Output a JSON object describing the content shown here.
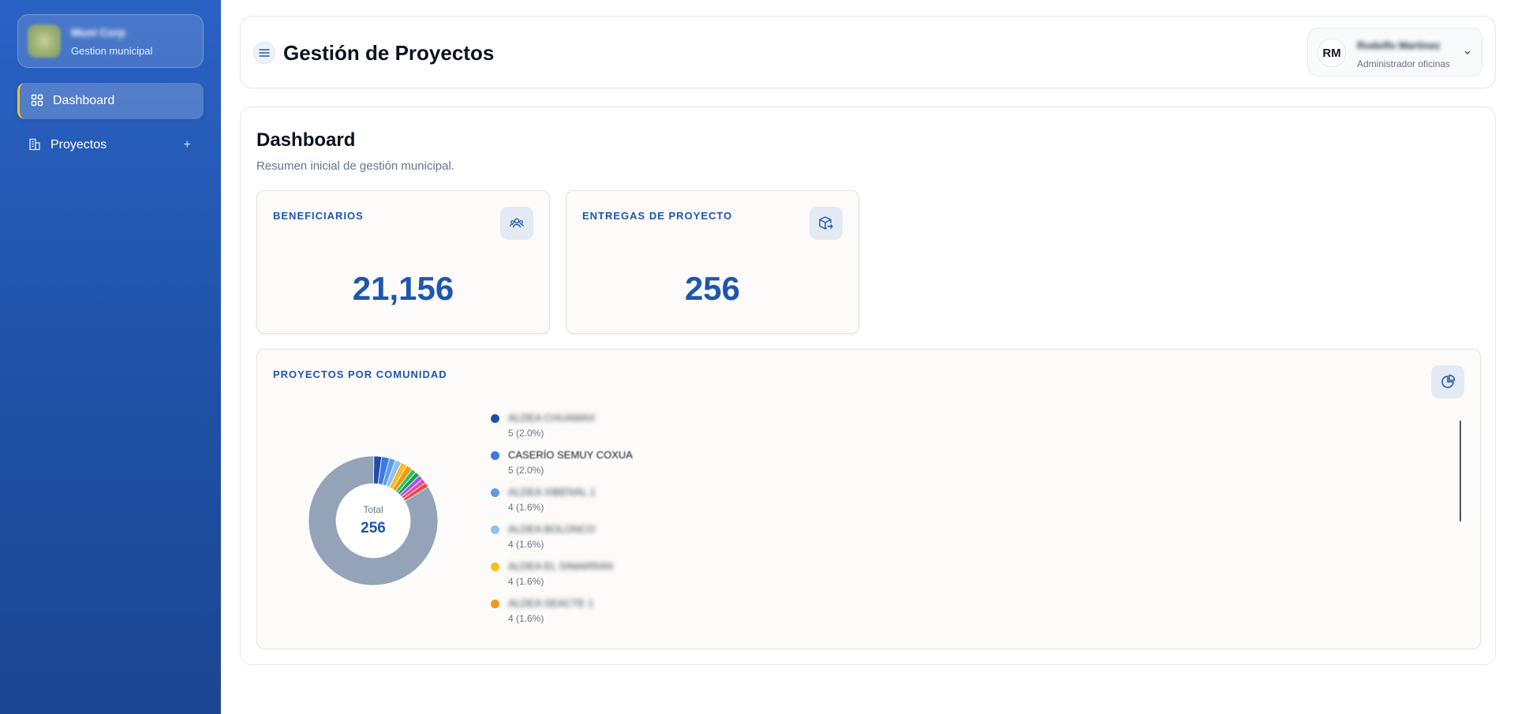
{
  "sidebar": {
    "brand": {
      "name": "Muni Corp",
      "subtitle": "Gestion municipal"
    },
    "items": [
      {
        "label": "Dashboard",
        "icon": "grid-icon",
        "active": true
      },
      {
        "label": "Proyectos",
        "icon": "building-icon",
        "expand": "+"
      }
    ]
  },
  "header": {
    "title": "Gestión de Proyectos",
    "user": {
      "initials": "RM",
      "name": "Rodolfo Martinez",
      "role": "Administrador oficinas"
    }
  },
  "dashboard": {
    "title": "Dashboard",
    "subtitle": "Resumen inicial de gestión municipal.",
    "cards": [
      {
        "label": "BENEFICIARIOS",
        "value": "21,156",
        "icon": "users-icon"
      },
      {
        "label": "ENTREGAS DE PROYECTO",
        "value": "256",
        "icon": "box-arrow-icon"
      }
    ],
    "chart": {
      "label": "PROYECTOS POR COMUNIDAD",
      "icon": "pie-chart-icon",
      "total_label": "Total",
      "total_value": "256"
    }
  },
  "chart_data": {
    "type": "pie",
    "title": "PROYECTOS POR COMUNIDAD",
    "total": 256,
    "series": [
      {
        "name": "ALDEA CHUAMAX",
        "value": 5,
        "percent": "5 (2.0%)",
        "color": "#1e4fa8"
      },
      {
        "name": "CASERÍO SEMUY COXUA",
        "value": 5,
        "percent": "5 (2.0%)",
        "color": "#3b7be0"
      },
      {
        "name": "ALDEA XIBENAL 1",
        "value": 4,
        "percent": "4 (1.6%)",
        "color": "#5f9ae8"
      },
      {
        "name": "ALDEA BOLONCO",
        "value": 4,
        "percent": "4 (1.6%)",
        "color": "#93bff2"
      },
      {
        "name": "ALDEA EL SIMARRAN",
        "value": 4,
        "percent": "4 (1.6%)",
        "color": "#f8be1a"
      },
      {
        "name": "ALDEA SEACTE 1",
        "value": 4,
        "percent": "4 (1.6%)",
        "color": "#f39a12"
      }
    ],
    "other_slice_colors": [
      "#22c55e",
      "#16a34a",
      "#a855f7",
      "#ec4899",
      "#ef4444"
    ],
    "remainder_color": "#94a3b8"
  }
}
